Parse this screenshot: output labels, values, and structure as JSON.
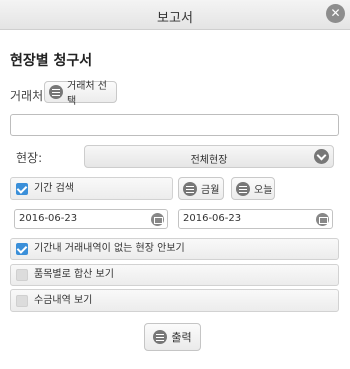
{
  "dialog": {
    "title": "보고서",
    "close_icon": "close-icon"
  },
  "form": {
    "heading": "현장별 청구서",
    "client": {
      "label": "거래처",
      "select_button": "거래처 선택",
      "input_value": ""
    },
    "site": {
      "label": "현장:",
      "selected": "전체현장"
    },
    "period": {
      "label": "기간 검색",
      "checked": true,
      "this_month_button": "금월",
      "today_button": "오늘",
      "start_date": "2016-06-23",
      "end_date": "2016-06-23"
    },
    "options": [
      {
        "label": "기간내 거래내역이 없는 현장 안보기",
        "checked": true
      },
      {
        "label": "품목별로 합산 보기",
        "checked": false
      },
      {
        "label": "수금내역 보기",
        "checked": false
      }
    ],
    "print_button": "출력"
  },
  "colors": {
    "accent": "#3a8fd9",
    "icon_gray": "#777777"
  }
}
